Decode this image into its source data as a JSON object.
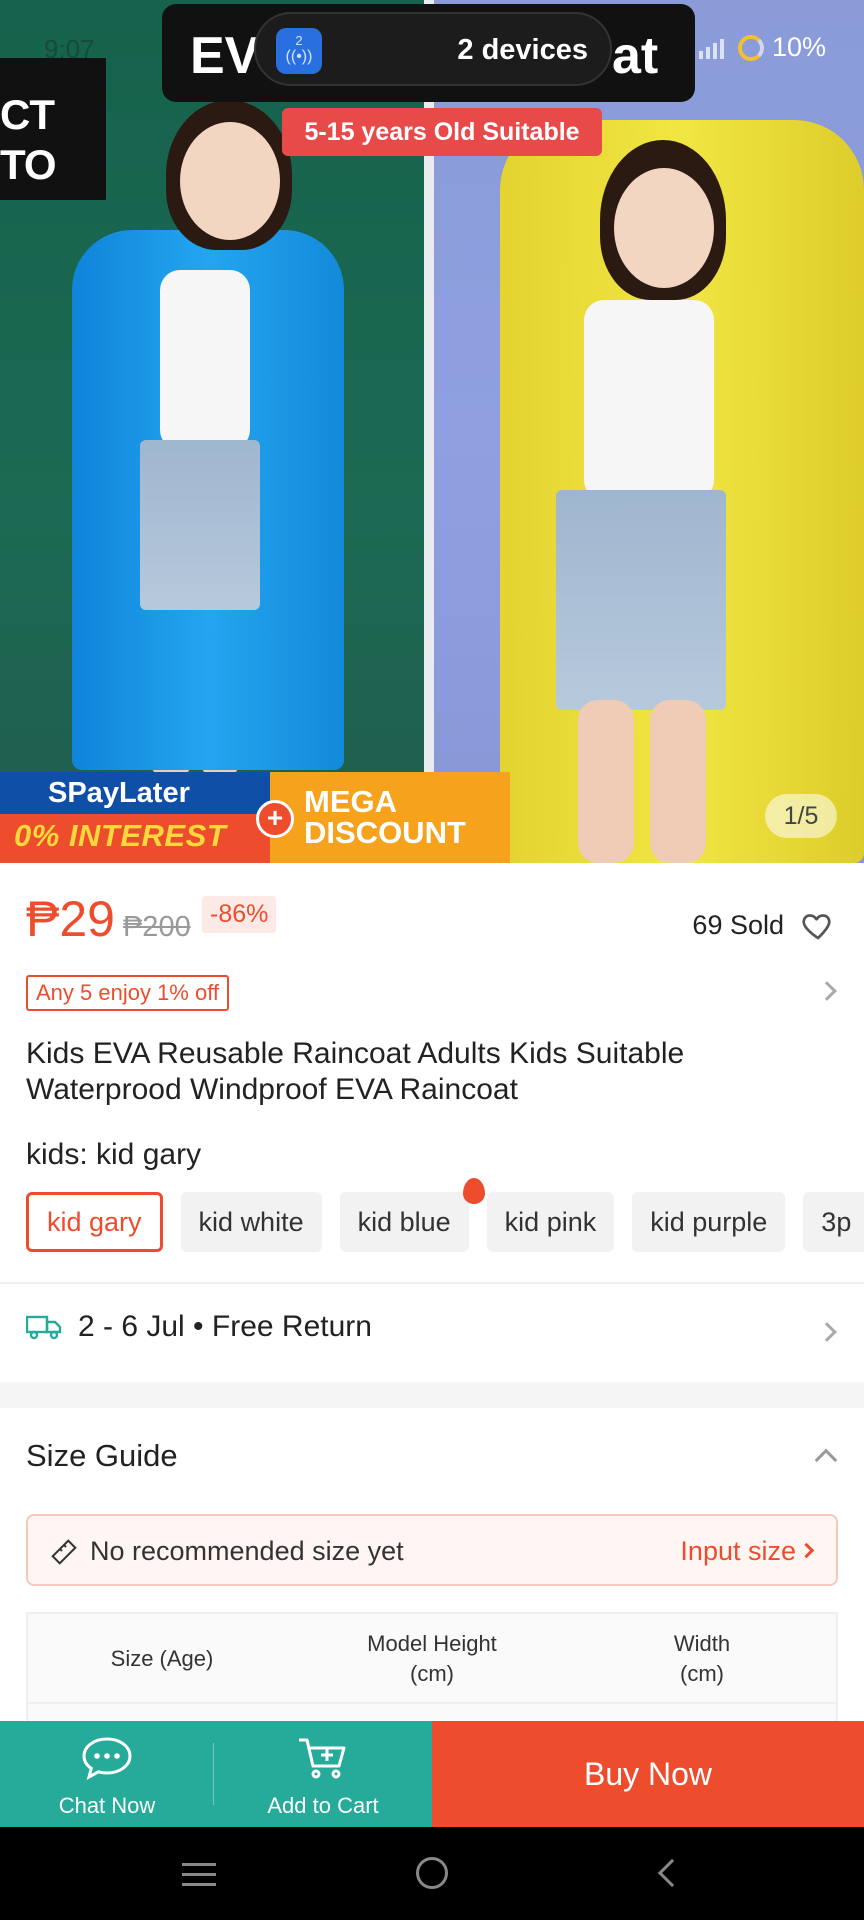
{
  "status_bar": {
    "time": "9:07",
    "battery": "10%"
  },
  "overlay": {
    "title_left": "EV",
    "title_right": "at",
    "devices_badge": "2",
    "devices_text": "2 devices"
  },
  "hero": {
    "corner_text_1": "CT",
    "corner_text_2": "TO",
    "suitable_tag": "5-15 years Old Suitable",
    "paylater_title": "SPayLater",
    "paylater_interest": "0% INTEREST",
    "mega_line1": "MEGA",
    "mega_line2": "DISCOUNT",
    "image_counter": "1/5"
  },
  "product": {
    "price": "₱29",
    "price_original": "₱200",
    "discount": "-86%",
    "sold": "69 Sold",
    "promo": "Any 5 enjoy 1% off",
    "title": "Kids EVA Reusable Raincoat Adults Kids Suitable Waterprood Windproof EVA Raincoat",
    "variant_label": "kids: kid gary",
    "variants": [
      {
        "label": "kid gary"
      },
      {
        "label": "kid white"
      },
      {
        "label": "kid blue"
      },
      {
        "label": "kid pink"
      },
      {
        "label": "kid purple"
      },
      {
        "label": "3p"
      }
    ]
  },
  "shipping": {
    "text": "2 - 6 Jul • Free Return"
  },
  "size_guide": {
    "title": "Size Guide",
    "recommend_text": "No recommended size yet",
    "input_link": "Input size",
    "columns": [
      {
        "line1": "Size (Age)",
        "line2": ""
      },
      {
        "line1": "Model Height",
        "line2": "(cm)"
      },
      {
        "line1": "Width",
        "line2": "(cm)"
      }
    ]
  },
  "actions": {
    "chat": "Chat Now",
    "cart": "Add to Cart",
    "buy": "Buy Now"
  },
  "colors": {
    "accent": "#ee4d2d",
    "teal": "#26aa99"
  }
}
